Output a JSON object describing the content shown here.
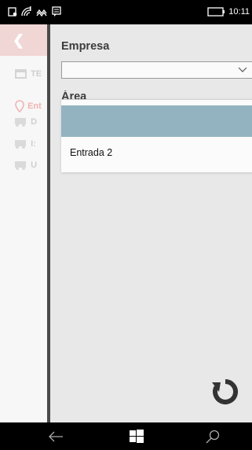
{
  "status_bar": {
    "time": "10:11",
    "icons": [
      "notification-icon",
      "wifi-icon",
      "vibrate-icon",
      "message-icon",
      "battery-icon"
    ]
  },
  "background_app": {
    "accent_color": "#f1d6d6",
    "items": [
      {
        "label": "TE",
        "icon": "calendar-icon"
      },
      {
        "label": "Ent",
        "icon": "location-pin-icon"
      },
      {
        "label": "D",
        "icon": "truck-icon"
      },
      {
        "label": "I:",
        "icon": "truck-icon"
      },
      {
        "label": "U",
        "icon": "truck-icon"
      }
    ]
  },
  "drawer": {
    "empresa_label": "Empresa",
    "empresa_value": "",
    "area_label": "Área",
    "dropdown": {
      "options": [
        {
          "label": "",
          "selected": true
        },
        {
          "label": "Entrada 2",
          "selected": false
        }
      ],
      "selected_color": "#93b3c1"
    }
  },
  "nav_bar": {
    "buttons": [
      "back-icon",
      "windows-icon",
      "search-icon"
    ]
  }
}
